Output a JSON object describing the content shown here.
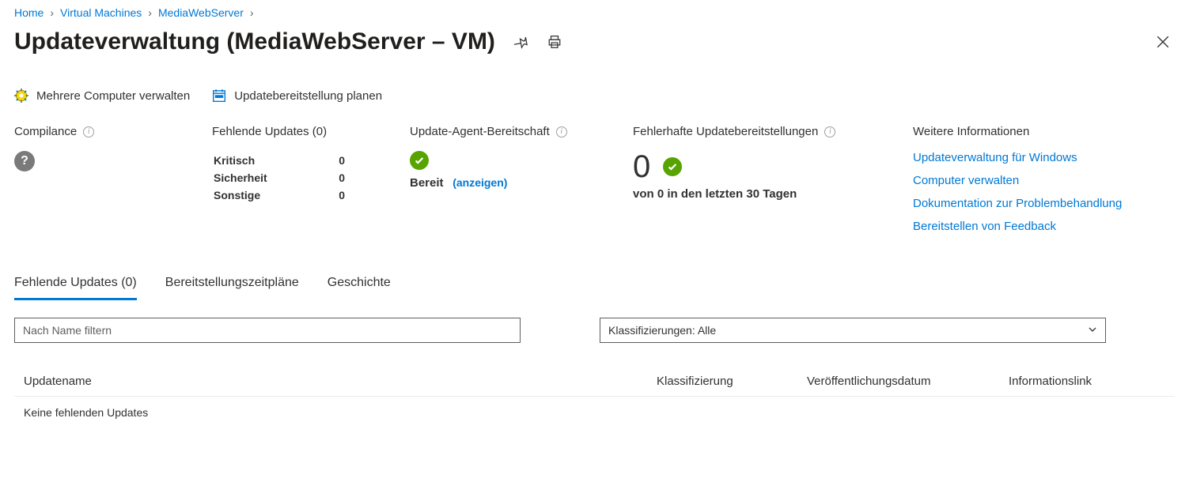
{
  "breadcrumb": {
    "items": [
      "Home",
      "Virtual Machines",
      "MediaWebServer"
    ]
  },
  "header": {
    "title": "Updateverwaltung (MediaWebServer – VM)"
  },
  "toolbar": {
    "manage_multiple": "Mehrere Computer verwalten",
    "schedule_deployment": "Updatebereitstellung planen"
  },
  "stats": {
    "compliance": {
      "label": "Compilance"
    },
    "missing": {
      "label": "Fehlende Updates (0)",
      "rows": [
        {
          "label": "Kritisch",
          "value": "0"
        },
        {
          "label": "Sicherheit",
          "value": "0"
        },
        {
          "label": "Sonstige",
          "value": "0"
        }
      ]
    },
    "agent": {
      "label": "Update-Agent-Bereitschaft",
      "status": "Bereit",
      "link_text": "(anzeigen)"
    },
    "failed": {
      "label": "Fehlerhafte Updatebereitstellungen",
      "count": "0",
      "subtext": "von 0 in den letzten 30 Tagen"
    },
    "more_info": {
      "label": "Weitere Informationen",
      "links": [
        "Updateverwaltung für Windows",
        "Computer verwalten",
        "Dokumentation zur Problembehandlung",
        "Bereitstellen von Feedback"
      ]
    }
  },
  "tabs": {
    "items": [
      {
        "label": "Fehlende Updates (0)",
        "active": true
      },
      {
        "label": "Bereitstellungszeitpläne",
        "active": false
      },
      {
        "label": "Geschichte",
        "active": false
      }
    ]
  },
  "filters": {
    "search_placeholder": "Nach Name filtern",
    "classification": "Klassifizierungen: Alle"
  },
  "table": {
    "columns": [
      "Updatename",
      "Klassifizierung",
      "Veröffentlichungsdatum",
      "Informationslink"
    ],
    "empty_text": "Keine fehlenden Updates"
  },
  "colors": {
    "link": "#0078d4",
    "success": "#57a300"
  }
}
